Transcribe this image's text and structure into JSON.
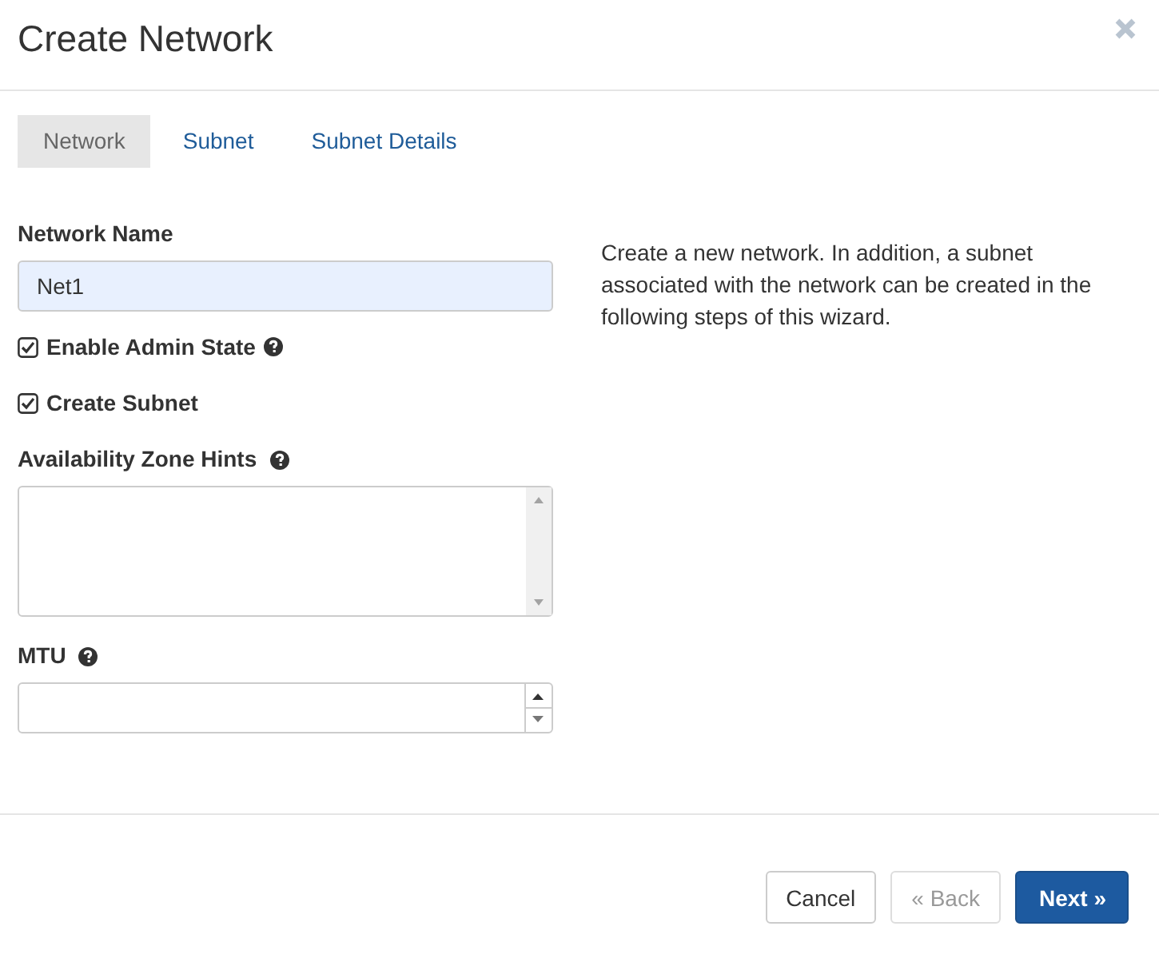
{
  "dialog": {
    "title": "Create Network"
  },
  "tabs": [
    {
      "label": "Network",
      "selected": true
    },
    {
      "label": "Subnet",
      "selected": false
    },
    {
      "label": "Subnet Details",
      "selected": false
    }
  ],
  "network_name": {
    "label": "Network Name",
    "value": "Net1"
  },
  "checkboxes": [
    {
      "label": "Enable Admin State",
      "checked": true,
      "help": true
    },
    {
      "label": "Create Subnet",
      "checked": true,
      "help": false
    }
  ],
  "availability_zone_hints": {
    "label": "Availability Zone Hints",
    "help": true
  },
  "mtu": {
    "label": "MTU",
    "help": true
  },
  "description": "Create a new network. In addition, a subnet associated with the network can be created in the following steps of this wizard.",
  "buttons": [
    {
      "label": "Cancel",
      "kind": "default",
      "disabled": false
    },
    {
      "label": "« Back",
      "kind": "default",
      "disabled": true
    },
    {
      "label": "Next »",
      "kind": "primary",
      "disabled": false
    }
  ]
}
